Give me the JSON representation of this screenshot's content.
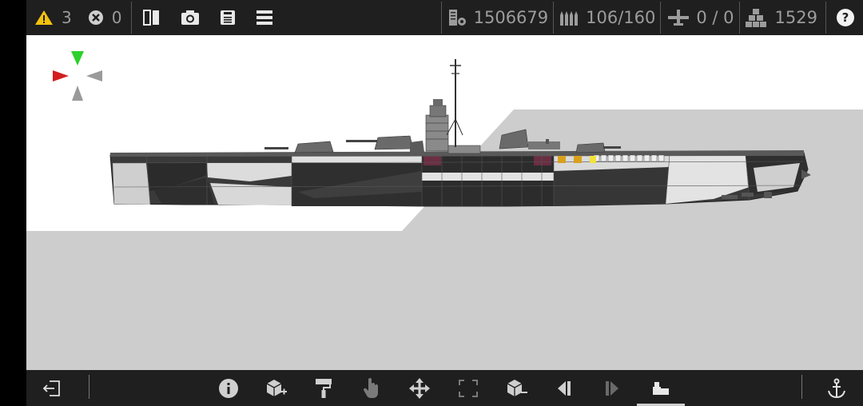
{
  "topbar": {
    "warnings": {
      "icon": "warning-icon",
      "count": "3",
      "color": "#f4c20d"
    },
    "errors": {
      "icon": "error-circle-icon",
      "count": "0"
    },
    "tools": [
      {
        "name": "mirror-view-icon"
      },
      {
        "name": "screenshot-camera-icon"
      },
      {
        "name": "save-disk-icon"
      },
      {
        "name": "menu-icon"
      }
    ],
    "stats": {
      "weight": {
        "icon": "weight-icon",
        "value": "1506679"
      },
      "ammo": {
        "icon": "ammo-shells-icon",
        "value": "106/160"
      },
      "aircraft": {
        "icon": "aircraft-icon",
        "value": "0 / 0"
      },
      "parts": {
        "icon": "parts-cubes-icon",
        "value": "1529"
      }
    },
    "help_icon": "help-icon"
  },
  "viewport": {
    "compass_colors": {
      "up": "#2bd12b",
      "left": "#d21f1f",
      "right": "#9a9a9a",
      "down": "#9a9a9a"
    },
    "ground_color": "#cdcdcd"
  },
  "bottombar": {
    "buttons": [
      "exit-icon",
      "info-icon",
      "add-part-icon",
      "paint-roller-icon",
      "hand-select-icon",
      "move-arrows-icon",
      "resize-frame-icon",
      "remove-part-icon",
      "step-back-icon",
      "step-forward-icon",
      "ship-build-icon",
      "anchor-icon"
    ],
    "active": "ship-build-icon"
  }
}
